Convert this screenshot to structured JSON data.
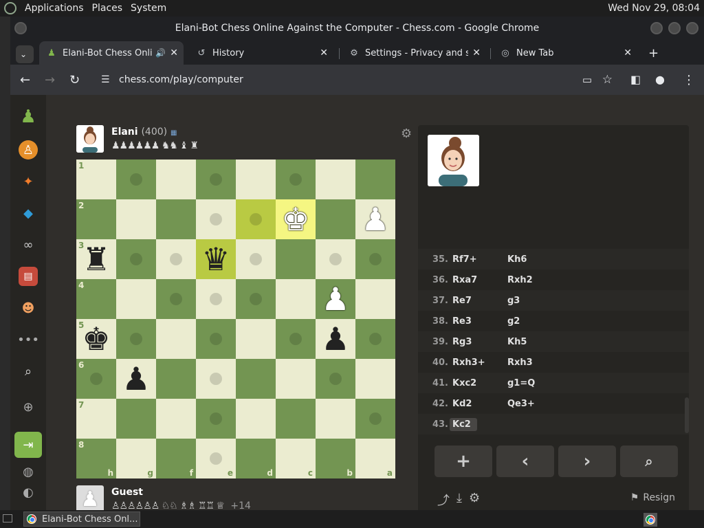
{
  "desktop": {
    "menu": [
      "Applications",
      "Places",
      "System"
    ],
    "clock": "Wed Nov 29, 08:04"
  },
  "window": {
    "title": "Elani-Bot Chess Online Against the Computer - Chess.com - Google Chrome"
  },
  "tabs": [
    {
      "label": "Elani-Bot Chess Online",
      "icon": "chess-pawn-icon"
    },
    {
      "label": "History",
      "icon": "history-icon"
    },
    {
      "label": "Settings - Privacy and sec",
      "icon": "gear-icon"
    },
    {
      "label": "New Tab",
      "icon": "chrome-icon"
    }
  ],
  "address": {
    "url": "chess.com/play/computer"
  },
  "opponent": {
    "name": "Elani",
    "rating": "(400)",
    "captured": "♟♟♟♟♟♟ ♞♞ ♝ ♜"
  },
  "player": {
    "name": "Guest",
    "captured": "♙♙♙♙♙♙ ♘♘ ♗♗ ♖♖ ♕",
    "advantage": "+14"
  },
  "board": {
    "ranks": [
      "1",
      "2",
      "3",
      "4",
      "5",
      "6",
      "7",
      "8"
    ],
    "files": [
      "h",
      "g",
      "f",
      "e",
      "d",
      "c",
      "b",
      "a"
    ]
  },
  "moves": [
    {
      "num": "35.",
      "white": "Rf7+",
      "black": "Kh6"
    },
    {
      "num": "36.",
      "white": "Rxa7",
      "black": "Rxh2"
    },
    {
      "num": "37.",
      "white": "Re7",
      "black": "g3"
    },
    {
      "num": "38.",
      "white": "Re3",
      "black": "g2"
    },
    {
      "num": "39.",
      "white": "Rg3",
      "black": "Kh5"
    },
    {
      "num": "40.",
      "white": "Rxh3+",
      "black": "Rxh3"
    },
    {
      "num": "41.",
      "white": "Kxc2",
      "black": "g1=Q"
    },
    {
      "num": "42.",
      "white": "Kd2",
      "black": "Qe3+"
    },
    {
      "num": "43.",
      "white": "Kc2",
      "black": ""
    }
  ],
  "controls": {
    "resign": "Resign"
  },
  "taskbar": {
    "item": "Elani-Bot Chess Onl..."
  }
}
